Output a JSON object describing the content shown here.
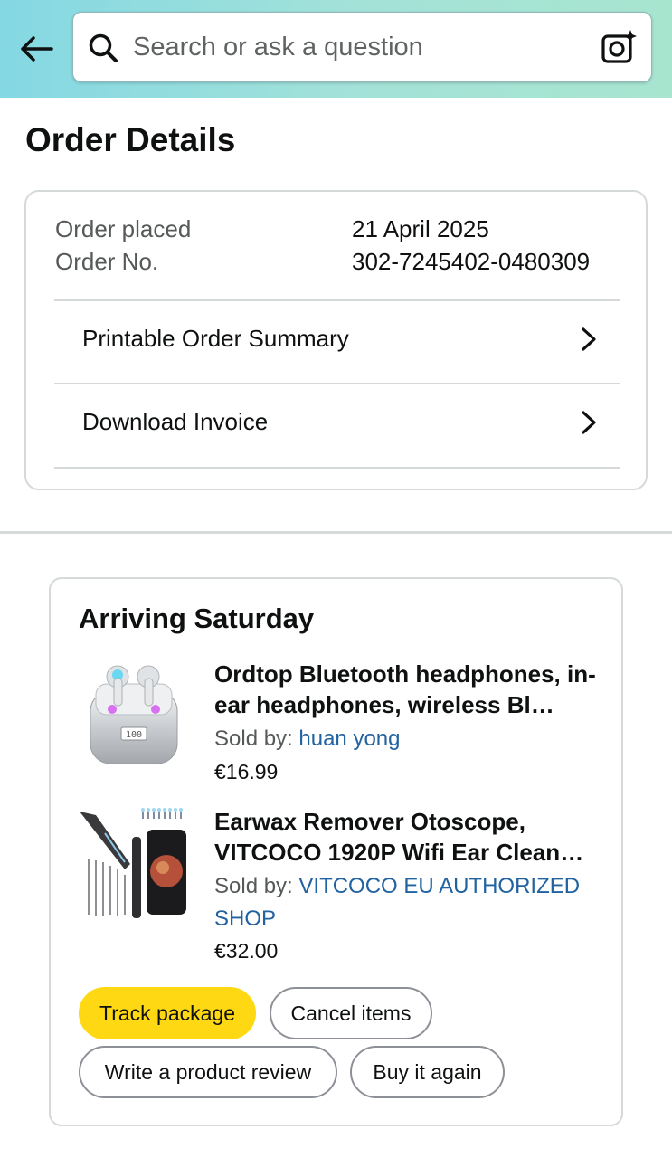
{
  "header": {
    "search_placeholder": "Search or ask a question",
    "back_icon": "arrow-left-icon",
    "search_icon": "search-icon",
    "camera_icon": "camera-sparkle-icon"
  },
  "page": {
    "title": "Order Details"
  },
  "order": {
    "placed_label": "Order placed",
    "placed_value": "21 April 2025",
    "number_label": "Order No.",
    "number_value": "302-7245402-0480309",
    "links": [
      {
        "label": "Printable Order Summary"
      },
      {
        "label": "Download Invoice"
      }
    ]
  },
  "shipment": {
    "title": "Arriving Saturday",
    "items": [
      {
        "name": "Ordtop Bluetooth headphones, in-ear headphones, wireless Bl…",
        "sold_by_label": "Sold by:",
        "seller": "huan yong",
        "price": "€16.99"
      },
      {
        "name": "Earwax Remover Otoscope, VITCOCO 1920P Wifi Ear Clean…",
        "sold_by_label": "Sold by:",
        "seller": "VITCOCO EU AUTHORIZED SHOP",
        "price": "€32.00"
      }
    ],
    "actions": {
      "track": "Track package",
      "cancel": "Cancel items",
      "review": "Write a product review",
      "buy_again": "Buy it again"
    }
  },
  "colors": {
    "accent_yellow": "#ffd814",
    "link_blue": "#2162a1",
    "header_gradient_start": "#84d8e3",
    "header_gradient_end": "#a8e5cf"
  }
}
